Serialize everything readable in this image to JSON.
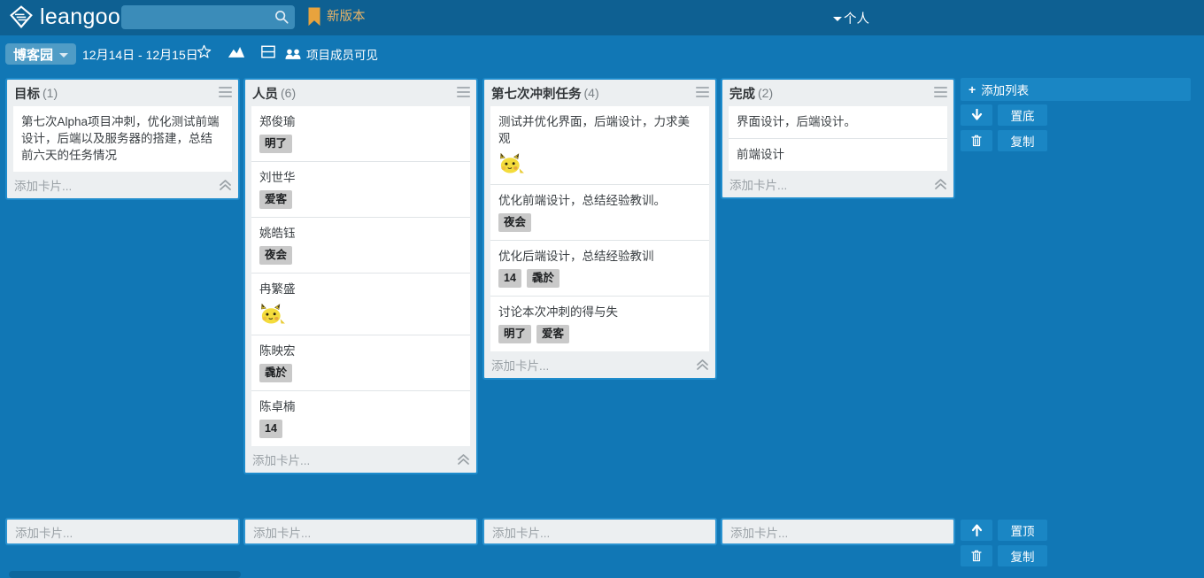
{
  "topbar": {
    "brand_name": "leangoo",
    "logo_icon": "leangoo-diamond-logo",
    "search_placeholder": "",
    "search_value": "",
    "search_icon": "search-icon",
    "bookmark_icon": "bookmark-icon",
    "new_version_label": "新版本",
    "new_version_color": "#e8b367",
    "user_menu_label": "个人",
    "background_color": "#0e6092"
  },
  "boardbar": {
    "board_name": "博客园",
    "date_range": "12月14日 - 12月15日",
    "icons": [
      "star-icon",
      "chart-icon",
      "calendar-icon"
    ],
    "visibility_icon": "group-icon",
    "visibility_label": "项目成员可见",
    "background_color": "#1177b5"
  },
  "lists": [
    {
      "title": "目标",
      "count": "(1)",
      "menu_icon": "hamburger-menu-icon",
      "add_card_placeholder": "添加卡片...",
      "collapse_icon": "double-chevron-up-icon",
      "cards": [
        {
          "text": "第七次Alpha项目冲刺，优化测试前端设计，后端以及服务器的搭建，总结前六天的任务情况",
          "badges": [],
          "avatar": ""
        }
      ]
    },
    {
      "title": "人员",
      "count": "(6)",
      "menu_icon": "hamburger-menu-icon",
      "add_card_placeholder": "添加卡片...",
      "collapse_icon": "double-chevron-up-icon",
      "cards": [
        {
          "text": "郑俊瑜",
          "badges": [
            "明了"
          ],
          "avatar": ""
        },
        {
          "text": "刘世华",
          "badges": [
            "爱客"
          ],
          "avatar": ""
        },
        {
          "text": "姚皓钰",
          "badges": [
            "夜会"
          ],
          "avatar": ""
        },
        {
          "text": "冉繁盛",
          "badges": [],
          "avatar": "pikachu-avatar"
        },
        {
          "text": "陈映宏",
          "badges": [
            "毳於"
          ],
          "avatar": ""
        },
        {
          "text": "陈卓楠",
          "badges": [
            "14"
          ],
          "avatar": ""
        }
      ]
    },
    {
      "title": "第七次冲刺任务",
      "count": "(4)",
      "menu_icon": "hamburger-menu-icon",
      "add_card_placeholder": "添加卡片...",
      "collapse_icon": "double-chevron-up-icon",
      "cards": [
        {
          "text": "测试并优化界面，后端设计，力求美观",
          "badges": [],
          "avatar": "pikachu-avatar"
        },
        {
          "text": "优化前端设计，总结经验教训。",
          "badges": [
            "夜会"
          ],
          "avatar": ""
        },
        {
          "text": "优化后端设计，总结经验教训",
          "badges": [
            "14",
            "毳於"
          ],
          "avatar": ""
        },
        {
          "text": "讨论本次冲刺的得与失",
          "badges": [
            "明了",
            "爱客"
          ],
          "avatar": ""
        }
      ]
    },
    {
      "title": "完成",
      "count": "(2)",
      "menu_icon": "hamburger-menu-icon",
      "add_card_placeholder": "添加卡片...",
      "collapse_icon": "double-chevron-up-icon",
      "cards": [
        {
          "text": "界面设计，后端设计。",
          "badges": [],
          "avatar": ""
        },
        {
          "text": "前端设计",
          "badges": [],
          "avatar": ""
        }
      ]
    }
  ],
  "right_panel": {
    "add_list_label": "添加列表",
    "add_list_icon": "plus-icon",
    "top_buttons": [
      {
        "icon": "arrow-down-icon",
        "label": "置底"
      },
      {
        "icon": "trash-icon",
        "label": "复制"
      }
    ],
    "bottom_buttons": [
      {
        "icon": "arrow-up-icon",
        "label": "置顶"
      },
      {
        "icon": "trash-icon",
        "label": "复制"
      }
    ]
  },
  "bottom_add_cards": [
    {
      "placeholder": "添加卡片..."
    },
    {
      "placeholder": "添加卡片..."
    },
    {
      "placeholder": "添加卡片..."
    },
    {
      "placeholder": "添加卡片..."
    }
  ]
}
